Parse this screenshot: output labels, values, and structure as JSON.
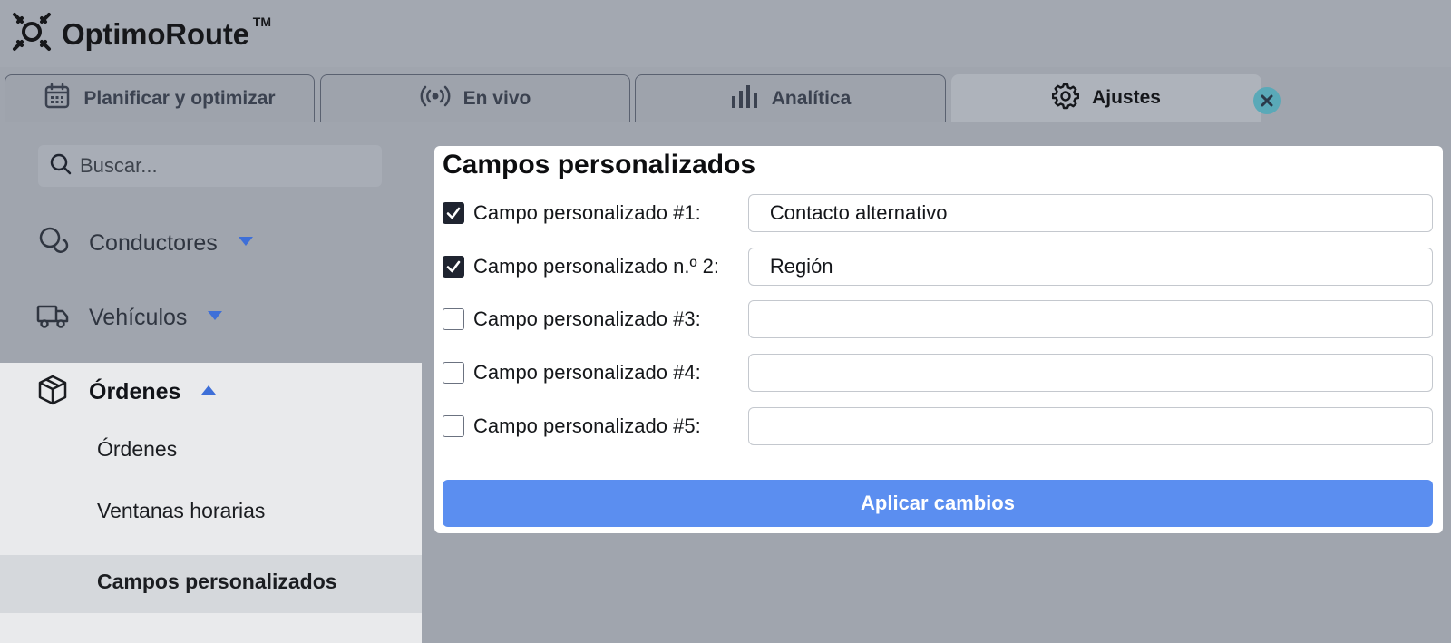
{
  "app": {
    "name": "OptimoRoute",
    "trademark": "TM"
  },
  "tabs": [
    {
      "label": "Planificar y optimizar",
      "icon": "calendar-icon",
      "active": false
    },
    {
      "label": "En vivo",
      "icon": "broadcast-icon",
      "active": false
    },
    {
      "label": "Analítica",
      "icon": "bar-chart-icon",
      "active": false
    },
    {
      "label": "Ajustes",
      "icon": "gear-icon",
      "active": true
    }
  ],
  "sidebar": {
    "search_placeholder": "Buscar...",
    "items": [
      {
        "label": "Conductores",
        "icon": "driver-icon",
        "expanded": false
      },
      {
        "label": "Vehículos",
        "icon": "truck-icon",
        "expanded": false
      },
      {
        "label": "Órdenes",
        "icon": "box-icon",
        "expanded": true
      }
    ],
    "sub_items": [
      {
        "label": "Órdenes"
      },
      {
        "label": "Ventanas horarias"
      },
      {
        "label": "Campos personalizados",
        "active": true
      }
    ]
  },
  "main": {
    "title": "Campos personalizados",
    "fields": [
      {
        "label": "Campo personalizado #1:",
        "checked": true,
        "value": "Contacto alternativo"
      },
      {
        "label": "Campo personalizado n.º 2:",
        "checked": true,
        "value": "Región"
      },
      {
        "label": "Campo personalizado #3:",
        "checked": false,
        "value": ""
      },
      {
        "label": "Campo personalizado #4:",
        "checked": false,
        "value": ""
      },
      {
        "label": "Campo personalizado #5:",
        "checked": false,
        "value": ""
      }
    ],
    "apply_label": "Aplicar cambios"
  },
  "colors": {
    "accent": "#5b8ef0",
    "nav_arrow": "#3e6fd8",
    "close": "#5aa9b8"
  }
}
